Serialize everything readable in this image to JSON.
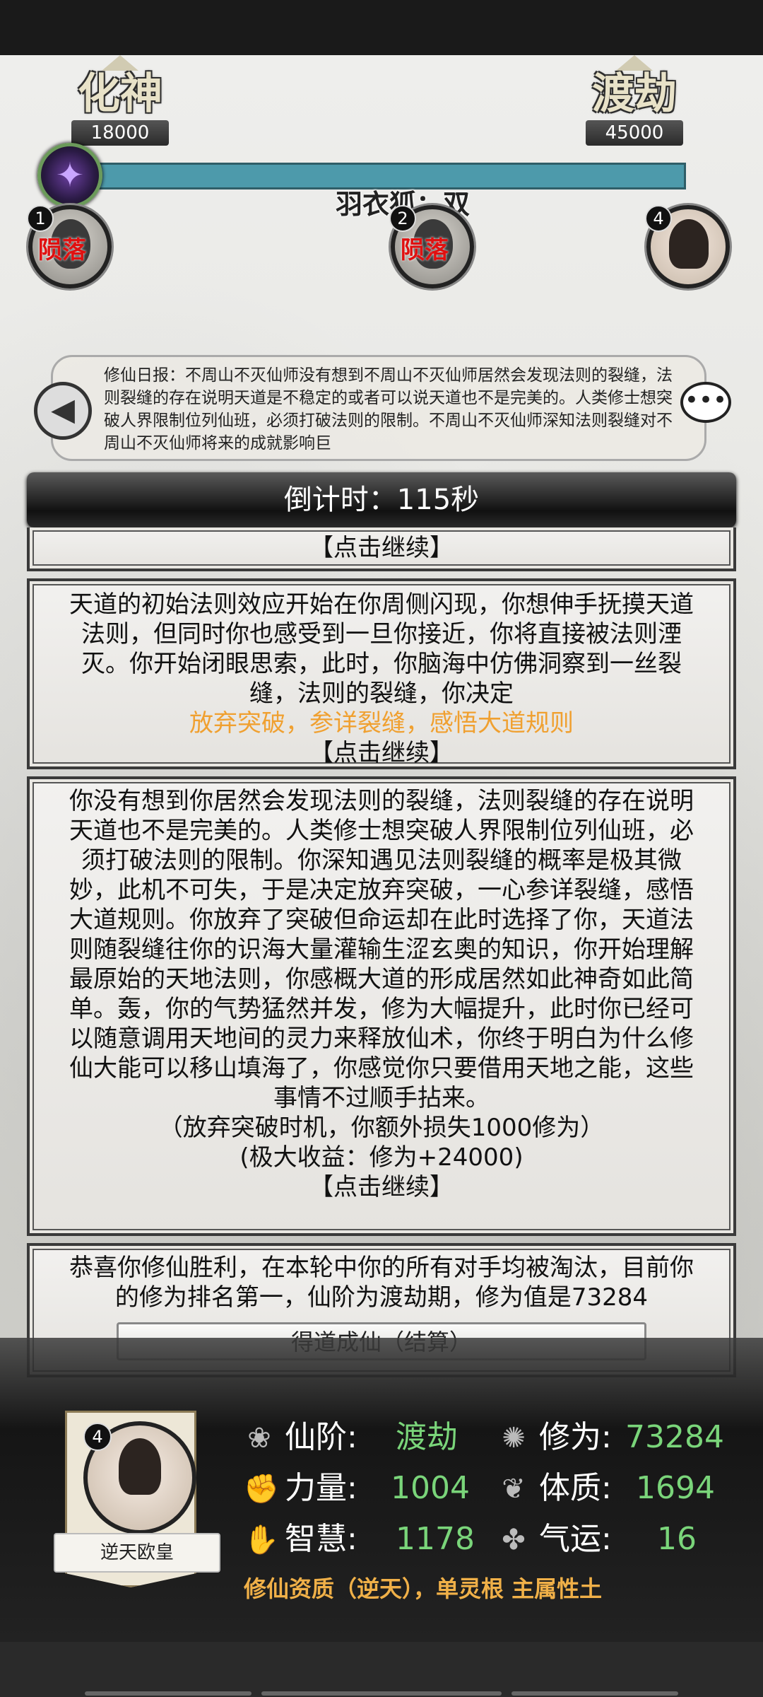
{
  "realms": {
    "current_name": "化神",
    "current_value": "18000",
    "next_name": "渡劫",
    "next_value": "45000"
  },
  "pet_icon": "purple-spirit-icon",
  "versus_text": "羽衣狐：双",
  "opponents": [
    {
      "num": "1",
      "status": "陨落"
    },
    {
      "num": "2",
      "status": "陨落"
    },
    {
      "num": "4",
      "status": ""
    }
  ],
  "news": {
    "text": "修仙日报：不周山不灭仙师没有想到不周山不灭仙师居然会发现法则的裂缝，法则裂缝的存在说明天道是不稳定的或者可以说天道也不是完美的。人类修士想突破人界限制位列仙班，必须打破法则的限制。不周山不灭仙师深知法则裂缝对不周山不灭仙师将来的成就影响巨"
  },
  "countdown": "倒计时：115秒",
  "story": {
    "continue_label": "【点击继续】",
    "panel1_text": "天道的初始法则效应开始在你周侧闪现，你想伸手抚摸天道法则，但同时你也感受到一旦你接近，你将直接被法则湮灭。你开始闭眼思索，此时，你脑海中仿佛洞察到一丝裂缝，法则的裂缝，你决定",
    "panel1_choice": "放弃突破，参详裂缝，感悟大道规则",
    "panel2_text": "你没有想到你居然会发现法则的裂缝，法则裂缝的存在说明天道也不是完美的。人类修士想突破人界限制位列仙班，必须打破法则的限制。你深知遇见法则裂缝的概率是极其微妙，此机不可失，于是决定放弃突破，一心参详裂缝，感悟大道规则。你放弃了突破但命运却在此时选择了你，天道法则随裂缝往你的识海大量灌输生涩玄奥的知识，你开始理解最原始的天地法则，你感概大道的形成居然如此神奇如此简单。轰，你的气势猛然并发，修为大幅提升，此时你已经可以随意调用天地间的灵力来释放仙术，你终于明白为什么修仙大能可以移山填海了，你感觉你只要借用天地之能，这些事情不过顺手拈来。",
    "panel2_loss": "（放弃突破时机，你额外损失1000修为）",
    "panel2_gain": "(极大收益：修为+24000)",
    "panel3_text": "恭喜你修仙胜利，在本轮中你的所有对手均被淘汰，目前你的修为排名第一，仙阶为渡劫期，修为值是73284",
    "settle_button": "得道成仙（结算）"
  },
  "player": {
    "rank_num": "4",
    "title": "逆天欧皇",
    "stats": {
      "realm_label": "仙阶:",
      "realm_value": "渡劫",
      "cultivation_label": "修为:",
      "cultivation_value": "73284",
      "strength_label": "力量:",
      "strength_value": "1004",
      "constitution_label": "体质:",
      "constitution_value": "1694",
      "wisdom_label": "智慧:",
      "wisdom_value": "1178",
      "luck_label": "气运:",
      "luck_value": "16"
    },
    "aptitude": "修仙资质（逆天），单灵根 主属性土"
  },
  "colors": {
    "progress": "#4d9aab",
    "fallen": "#e01010",
    "choice": "#f0a030",
    "stat_value": "#7ad57a",
    "aptitude": "#f0b048"
  }
}
